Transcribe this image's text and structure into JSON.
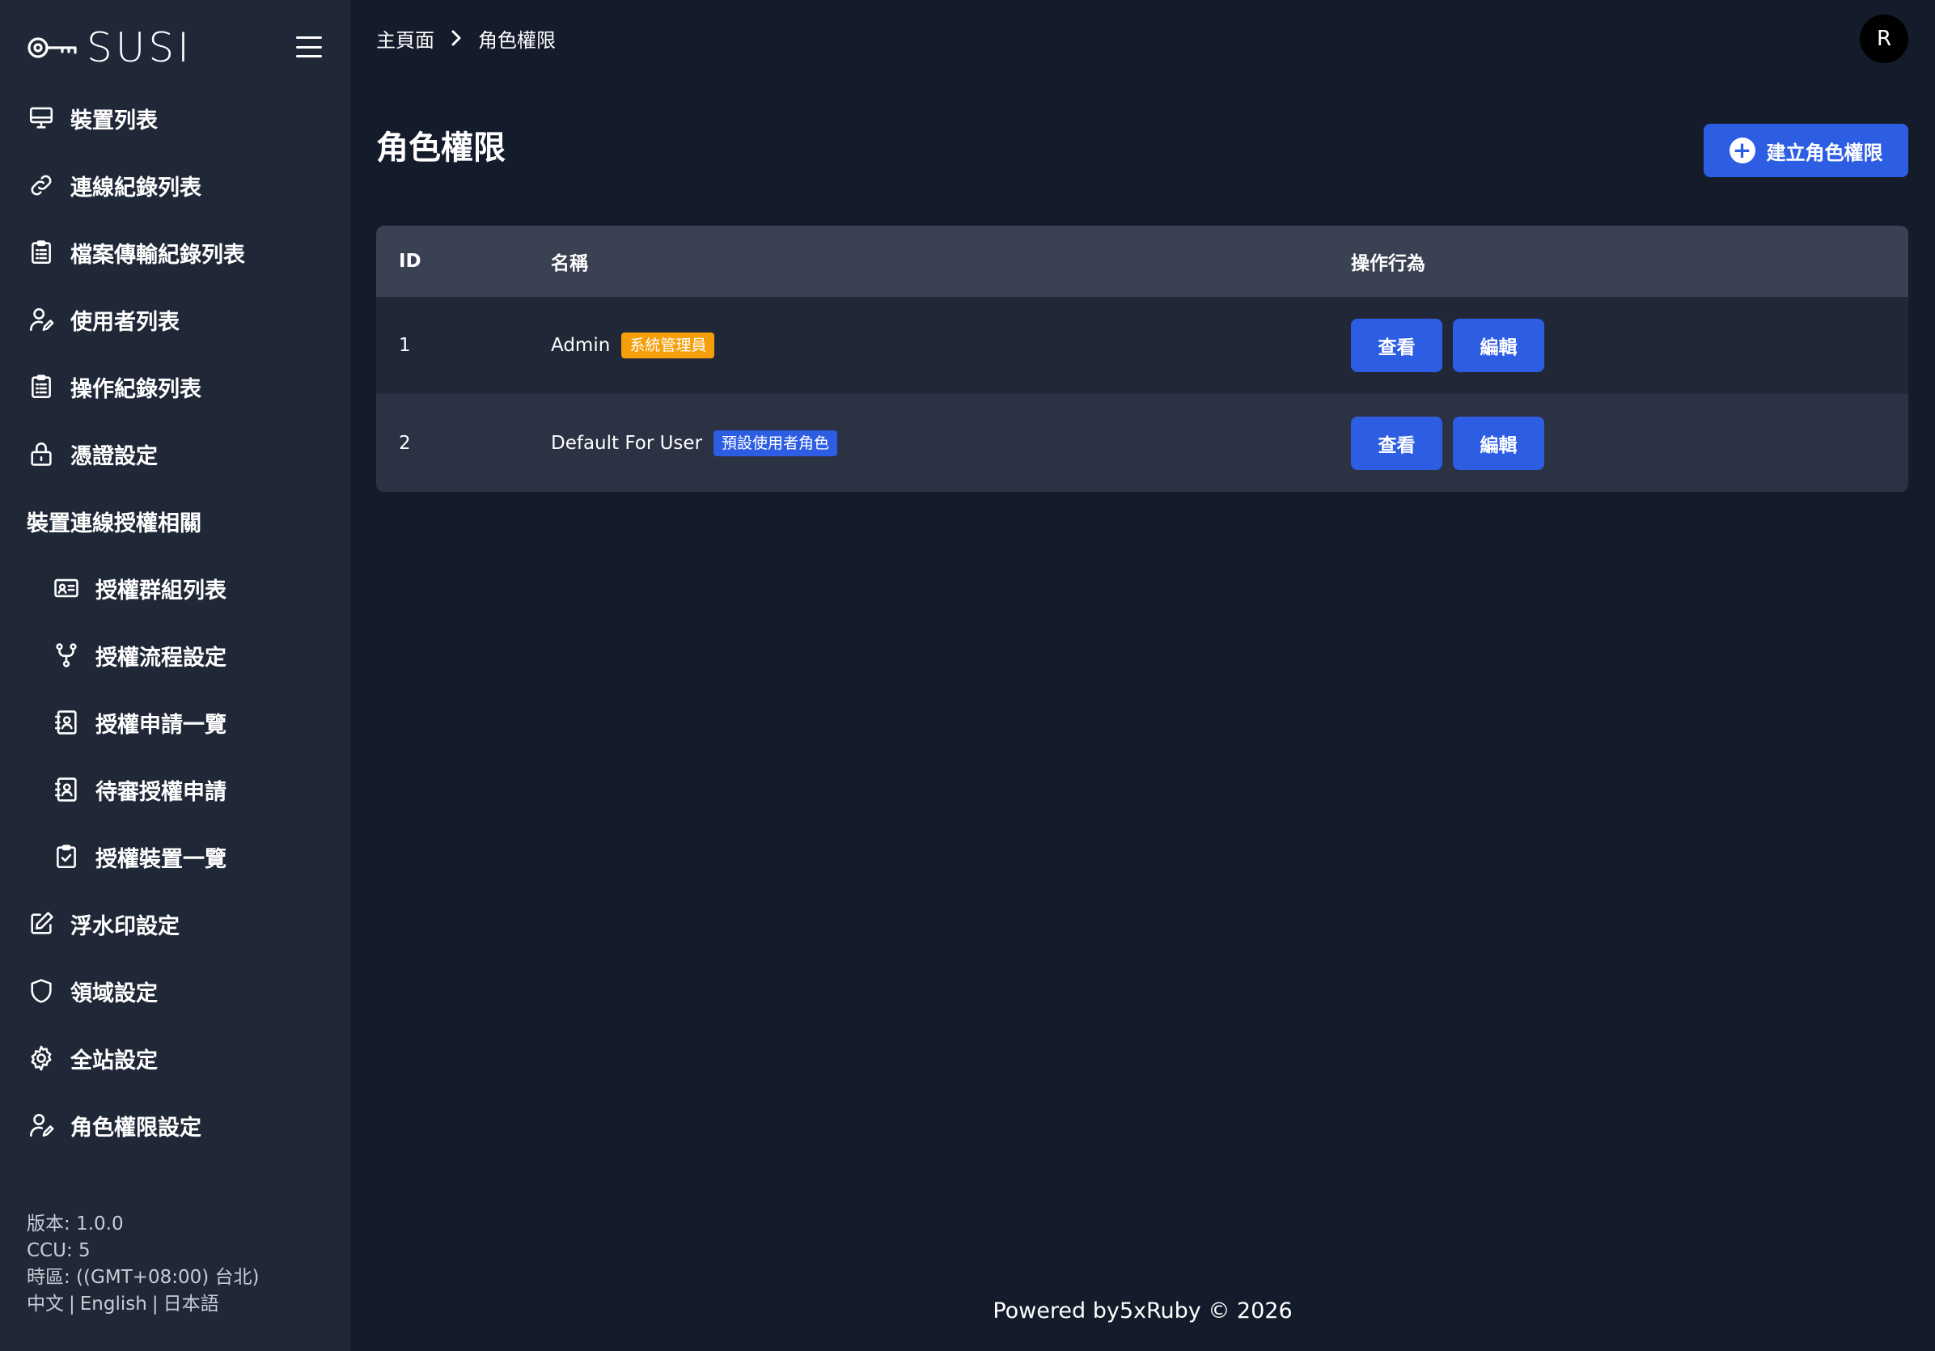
{
  "brand": {
    "name": "SUSI",
    "icon": "key-icon"
  },
  "sidebar": {
    "items": [
      {
        "label": "裝置列表",
        "icon": "monitor-icon"
      },
      {
        "label": "連線紀錄列表",
        "icon": "link-icon"
      },
      {
        "label": "檔案傳輸紀錄列表",
        "icon": "clipboard-list-icon"
      },
      {
        "label": "使用者列表",
        "icon": "user-edit-icon"
      },
      {
        "label": "操作紀錄列表",
        "icon": "clipboard-list-icon"
      },
      {
        "label": "憑證設定",
        "icon": "lock-icon"
      }
    ],
    "section_label": "裝置連線授權相關",
    "sub_items": [
      {
        "label": "授權群組列表",
        "icon": "id-card-icon"
      },
      {
        "label": "授權流程設定",
        "icon": "branch-icon"
      },
      {
        "label": "授權申請一覽",
        "icon": "contact-book-icon"
      },
      {
        "label": "待審授權申請",
        "icon": "contact-book-icon"
      },
      {
        "label": "授權裝置一覽",
        "icon": "clipboard-check-icon"
      }
    ],
    "items_after": [
      {
        "label": "浮水印設定",
        "icon": "edit-square-icon"
      },
      {
        "label": "領域設定",
        "icon": "shield-icon"
      },
      {
        "label": "全站設定",
        "icon": "gear-icon"
      },
      {
        "label": "角色權限設定",
        "icon": "user-edit-icon"
      }
    ],
    "footer": {
      "version": "版本: 1.0.0",
      "ccu": "CCU: 5",
      "timezone": "時區: ((GMT+08:00) 台北)",
      "languages": [
        "中文",
        "English",
        "日本語"
      ]
    }
  },
  "breadcrumb": {
    "home": "主頁面",
    "current": "角色權限"
  },
  "user": {
    "avatar_initial": "R"
  },
  "page": {
    "title": "角色權限",
    "create_button": "建立角色權限"
  },
  "table": {
    "headers": {
      "id": "ID",
      "name": "名稱",
      "actions": "操作行為"
    },
    "rows": [
      {
        "id": "1",
        "name": "Admin",
        "badge": "系統管理員",
        "badge_color": "#f59f0b",
        "view": "查看",
        "edit": "編輯"
      },
      {
        "id": "2",
        "name": "Default For User",
        "badge": "預設使用者角色",
        "badge_color": "#2d5de2",
        "view": "查看",
        "edit": "編輯"
      }
    ]
  },
  "footer": {
    "text": "Powered by5xRuby © 2026"
  },
  "colors": {
    "background": "#141b2b",
    "sidebar": "#202838",
    "table_header": "#3a4152",
    "primary": "#2d5de2",
    "badge_orange": "#f59f0b"
  }
}
